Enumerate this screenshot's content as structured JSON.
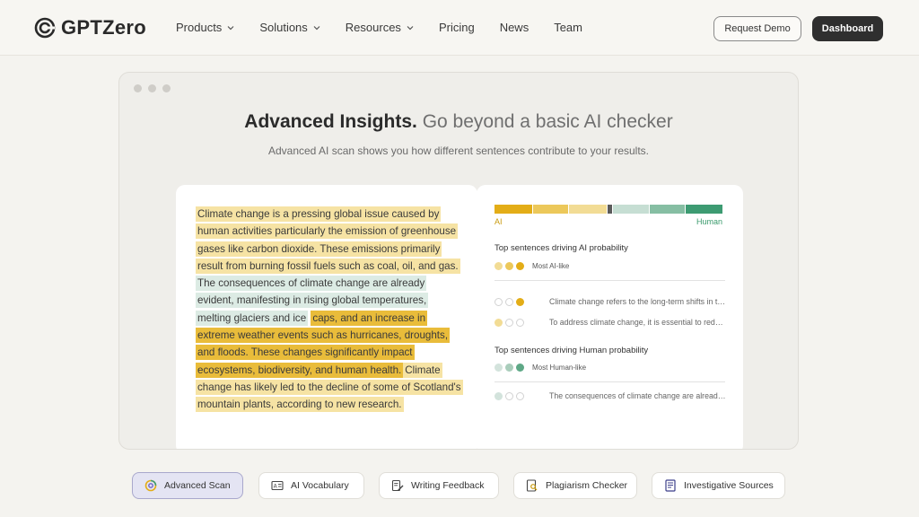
{
  "brand": {
    "name": "GPTZero",
    "icon": "gptzero-logo-icon"
  },
  "nav": {
    "links": [
      {
        "label": "Products",
        "has_dropdown": true
      },
      {
        "label": "Solutions",
        "has_dropdown": true
      },
      {
        "label": "Resources",
        "has_dropdown": true
      },
      {
        "label": "Pricing",
        "has_dropdown": false
      },
      {
        "label": "News",
        "has_dropdown": false
      },
      {
        "label": "Team",
        "has_dropdown": false
      }
    ],
    "request_demo": "Request Demo",
    "dashboard": "Dashboard"
  },
  "card": {
    "headline_bold": "Advanced Insights.",
    "headline_muted": "Go beyond a basic AI checker",
    "subline": "Advanced AI scan shows you how different sentences contribute to your results.",
    "passage": [
      {
        "text": "Climate change is a pressing global issue caused by human activities particularly the emission of greenhouse gases like carbon dioxide. These emissions primarily result from burning fossil fuels such as coal, oil, and gas.",
        "tone": "light-yellow"
      },
      {
        "text": "The consequences of climate change are already evident, manifesting in rising global temperatures, melting glaciers and ice",
        "tone": "light-green"
      },
      {
        "text": "caps, and an increase in extreme weather events such as hurricanes, droughts, and floods. These changes significantly impact ecosystems, biodiversity, and human health.",
        "tone": "dark-yellow"
      },
      {
        "text": "Climate change has likely led to the decline of some of Scotland's mountain plants, according to new research.",
        "tone": "light-yellow"
      }
    ],
    "scale": {
      "label_left": "AI",
      "label_right": "Human",
      "segments": [
        "#e3ad17",
        "#ecc85a",
        "#f2dc95",
        "#5b5b5b",
        "#c6ded3",
        "#86bea3",
        "#3d9b72"
      ]
    },
    "ai_section": {
      "title": "Top sentences driving AI probability",
      "legend": "Most AI-like",
      "sentences": [
        {
          "text": "Climate change refers to the long-term shifts in temperatures and weather patterns",
          "dots": [
            "empty",
            "empty",
            "dark-yellow"
          ]
        },
        {
          "text": "To address climate change, it is essential to reduce greenhouse gas emissions",
          "dots": [
            "light-yellow",
            "empty",
            "empty"
          ]
        }
      ]
    },
    "human_section": {
      "title": "Top sentences driving Human probability",
      "legend": "Most Human-like",
      "sentences": [
        {
          "text": "The consequences of climate change are already evident",
          "dots": [
            "light-green",
            "empty",
            "empty"
          ]
        }
      ]
    }
  },
  "tabs": [
    {
      "label": "Advanced Scan",
      "icon": "advanced-scan-icon",
      "active": true
    },
    {
      "label": "AI Vocabulary",
      "icon": "vocabulary-icon",
      "active": false
    },
    {
      "label": "Writing Feedback",
      "icon": "pencil-document-icon",
      "active": false
    },
    {
      "label": "Plagiarism Checker",
      "icon": "magnifier-document-icon",
      "active": false
    },
    {
      "label": "Investigative Sources",
      "icon": "document-sources-icon",
      "active": false
    }
  ]
}
